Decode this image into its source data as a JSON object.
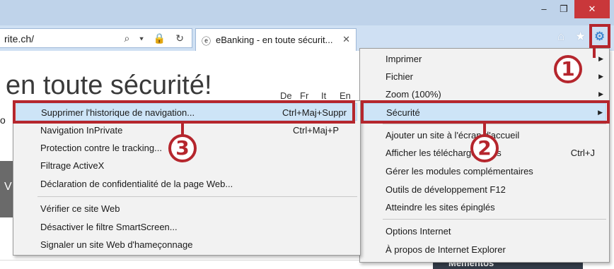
{
  "window": {
    "minimize_glyph": "–",
    "restore_glyph": "❐",
    "close_glyph": "✕"
  },
  "address_bar": {
    "url_text": "rite.ch/",
    "icons": "⌕ ▾ 🔒 ↻"
  },
  "tab": {
    "icon": "ⓔ",
    "title": "eBanking - en toute sécurit...",
    "close_glyph": "✕"
  },
  "toolbar": {
    "home_glyph": "⌂",
    "favorites_glyph": "★",
    "tools_glyph": "⚙"
  },
  "page": {
    "heading": "en toute sécurité!",
    "languages": [
      "De",
      "Fr",
      "It",
      "En"
    ],
    "side_letter": "o",
    "side_letter_2": "V",
    "mementos_label": "Mementos"
  },
  "tools_menu": {
    "items": [
      {
        "label": "Imprimer",
        "arrow": "▶"
      },
      {
        "label": "Fichier",
        "arrow": "▶"
      },
      {
        "label": "Zoom (100%)",
        "arrow": "▶"
      },
      {
        "label": "Sécurité",
        "arrow": "▶"
      },
      {
        "label": "Ajouter un site à l'écran d'accueil",
        "arrow": ""
      },
      {
        "label": "Afficher les téléchargements",
        "shortcut": "Ctrl+J"
      },
      {
        "label": "Gérer les modules complémentaires"
      },
      {
        "label": "Outils de développement F12"
      },
      {
        "label": "Atteindre les sites épinglés"
      },
      {
        "label": "Options Internet"
      },
      {
        "label": "À propos de Internet Explorer"
      }
    ]
  },
  "security_menu": {
    "items": [
      {
        "label": "Supprimer l'historique de navigation...",
        "shortcut": "Ctrl+Maj+Suppr"
      },
      {
        "label": "Navigation InPrivate",
        "shortcut": "Ctrl+Maj+P"
      },
      {
        "label": "Protection contre le tracking..."
      },
      {
        "label": "Filtrage ActiveX"
      },
      {
        "label": "Déclaration de confidentialité de la page Web..."
      },
      {
        "label": "Vérifier ce site Web"
      },
      {
        "label": "Désactiver le filtre SmartScreen..."
      },
      {
        "label": "Signaler un site Web d'hameçonnage"
      }
    ]
  },
  "callouts": [
    "1",
    "2",
    "3"
  ],
  "colors": {
    "annotation_red": "#b5262d",
    "highlight": "#cde4f7",
    "close_button": "#c9373a"
  }
}
